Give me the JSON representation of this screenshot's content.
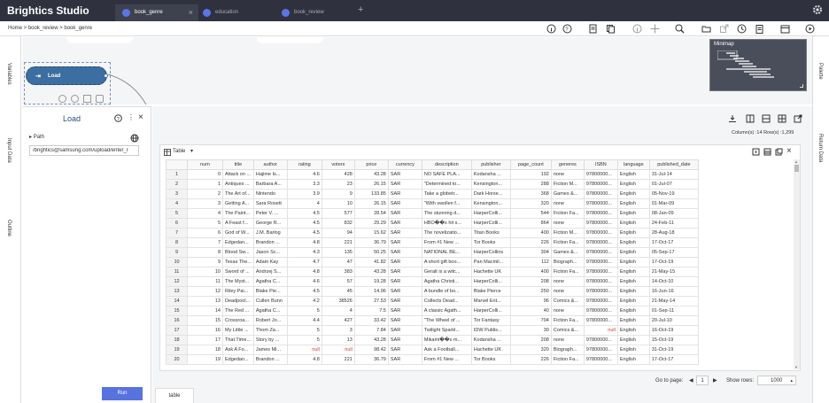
{
  "app": {
    "brand": "Brightics Studio"
  },
  "tabs": [
    {
      "label": "book_genre",
      "active": true
    },
    {
      "label": "education",
      "active": false
    },
    {
      "label": "book_review",
      "active": false
    }
  ],
  "breadcrumb": "Home > book_review > book_genre",
  "side_labels": {
    "variables": "Variables",
    "input_data": "Input Data",
    "outline": "Outline",
    "palette": "Palette",
    "return_data": "Return Data"
  },
  "minimap": {
    "title": "Minimap"
  },
  "node": {
    "label": "Load"
  },
  "load_panel": {
    "title": "Load",
    "path_label": "Path",
    "path_value": "/brightics@samsung.com/upload/enter_r",
    "run_label": "Run"
  },
  "result": {
    "counts": "Column(s) :14   Row(s) :1,299",
    "table_label": "Table",
    "goto_label": "Go to page:",
    "page_value": "1",
    "show_rows_label": "Show rows:",
    "show_rows_value": "1000",
    "bottom_tab": "table"
  },
  "table": {
    "columns": [
      "",
      "num",
      "title",
      "author",
      "rating",
      "voters",
      "price",
      "currency",
      "description",
      "publisher",
      "page_count",
      "generes",
      "ISBN",
      "language",
      "published_date"
    ],
    "rows": [
      [
        "1",
        "0",
        "Attack on ...",
        "Hajime Is...",
        "4.6",
        "428",
        "43.28",
        "SAR",
        "NO SAFE PLA...",
        "Kodansha ...",
        "192",
        "none",
        "97800000...",
        "English",
        "31-Jul-14"
      ],
      [
        "2",
        "1",
        "Antiques ...",
        "Barbara A...",
        "3.3",
        "23",
        "26.15",
        "SAR",
        "\"Determined to...",
        "Kensington...",
        "288",
        "Fiction M...",
        "97800000...",
        "English",
        "01-Jul-07"
      ],
      [
        "3",
        "2",
        "The Art of...",
        "Nintendo",
        "3.9",
        "9",
        "133.85",
        "SAR",
        "Take a globetr...",
        "Dark Horse...",
        "368",
        "Games &...",
        "97800000...",
        "English",
        "05-Nov-19"
      ],
      [
        "4",
        "3",
        "Getting A...",
        "Sara Rosett",
        "4",
        "10",
        "26.15",
        "SAR",
        "\"With swollen f...",
        "Kensington...",
        "320",
        "none",
        "97800000...",
        "English",
        "01-Mar-09"
      ],
      [
        "5",
        "4",
        "The Paint...",
        "Peter V. ...",
        "4.5",
        "577",
        "28.54",
        "SAR",
        "The stunning d...",
        "HarperColli...",
        "544",
        "Fiction Fa...",
        "97800000...",
        "English",
        "08-Jan-09"
      ],
      [
        "6",
        "5",
        "A Feast f...",
        "George R...",
        "4.5",
        "832",
        "29.29",
        "SAR",
        "HBO��s hit s...",
        "HarperColli...",
        "864",
        "none",
        "97800000...",
        "English",
        "24-Feb-11"
      ],
      [
        "7",
        "6",
        "God of W...",
        "J.M. Barlog",
        "4.5",
        "94",
        "15.62",
        "SAR",
        "The novelizatio...",
        "Titan Books",
        "400",
        "Fiction M...",
        "97800000...",
        "English",
        "28-Aug-18"
      ],
      [
        "8",
        "7",
        "Edgedan...",
        "Brandon ...",
        "4.8",
        "221",
        "36.79",
        "SAR",
        "From #1 New ...",
        "Tor Books",
        "226",
        "Fiction Fa...",
        "97800000...",
        "English",
        "17-Oct-17"
      ],
      [
        "9",
        "8",
        "Blood Sw...",
        "Jason Sc...",
        "4.3",
        "135",
        "50.25",
        "SAR",
        "NATIONAL BE...",
        "HarperCollins",
        "304",
        "Games &...",
        "97800000...",
        "English",
        "05-Sep-17"
      ],
      [
        "10",
        "9",
        "Texas The...",
        "Adam Kay",
        "4.7",
        "47",
        "41.82",
        "SAR",
        "A short gift boo...",
        "Pan Macmil...",
        "112",
        "Biograph...",
        "97800000...",
        "English",
        "17-Oct-19"
      ],
      [
        "11",
        "10",
        "Sword of ...",
        "Andrzej S...",
        "4.8",
        "383",
        "43.28",
        "SAR",
        "Geralt is a witc...",
        "Hachette UK",
        "400",
        "Fiction Fa...",
        "97800000...",
        "English",
        "21-May-15"
      ],
      [
        "12",
        "11",
        "The Myst...",
        "Agatha C...",
        "4.6",
        "57",
        "19.28",
        "SAR",
        "Agatha Christi...",
        "HarperColli...",
        "208",
        "none",
        "97800000...",
        "English",
        "14-Oct-10"
      ],
      [
        "13",
        "12",
        "Riley Pai...",
        "Blake Pie...",
        "4.5",
        "45",
        "14.96",
        "SAR",
        "A bundle of bo...",
        "Blake Pierce",
        "250",
        "none",
        "97800000...",
        "English",
        "16-Jun-16"
      ],
      [
        "14",
        "13",
        "Deadpool...",
        "Cullen Bunn",
        "4.2",
        "38526",
        "27.53",
        "SAR",
        "Collects Dead...",
        "Marvel Ent...",
        "96",
        "Comics &...",
        "97800000...",
        "English",
        "21-May-14"
      ],
      [
        "15",
        "14",
        "The Red ...",
        "Agatha C...",
        "5",
        "4",
        "7.5",
        "SAR",
        "A classic Agath...",
        "HarperColli...",
        "40",
        "none",
        "97800000...",
        "English",
        "01-Sep-11"
      ],
      [
        "16",
        "15",
        "Crossroa...",
        "Robert Jo...",
        "4.4",
        "427",
        "33.42",
        "SAR",
        "\"The Wheel of ...",
        "Tor Fantasy",
        "704",
        "Fiction Fa...",
        "97800000...",
        "English",
        "20-Jul-10"
      ],
      [
        "17",
        "16",
        "My Little ...",
        "Thom Za...",
        "5",
        "3",
        "7.84",
        "SAR",
        "Twilight Sparkl...",
        "IDW Publis...",
        "30",
        "Comics &...",
        "null",
        "English",
        "16-Oct-19"
      ],
      [
        "18",
        "17",
        "That Time...",
        "Story by ...",
        "5",
        "13",
        "43.28",
        "SAR",
        "Mikami��s m...",
        "Kodansha ...",
        "208",
        "none",
        "97800000...",
        "English",
        "15-Oct-19"
      ],
      [
        "19",
        "18",
        "Ask A Fo...",
        "James Mi...",
        "null",
        "null",
        "98.42",
        "SAR",
        "Ask a Football...",
        "Hachette UK",
        "320",
        "Biograph...",
        "97800000...",
        "English",
        "31-Oct-19"
      ],
      [
        "20",
        "19",
        "Edgedan...",
        "Brandon ...",
        "4.8",
        "221",
        "36.79",
        "SAR",
        "From #1 New ...",
        "Tor Books",
        "226",
        "Fiction Fa...",
        "97800000...",
        "English",
        "17-Oct-17"
      ]
    ]
  },
  "colors": {
    "topbar": "#2f323e",
    "accent": "#5673e0",
    "node": "#3c6ea1",
    "null_text": "#e03030"
  }
}
